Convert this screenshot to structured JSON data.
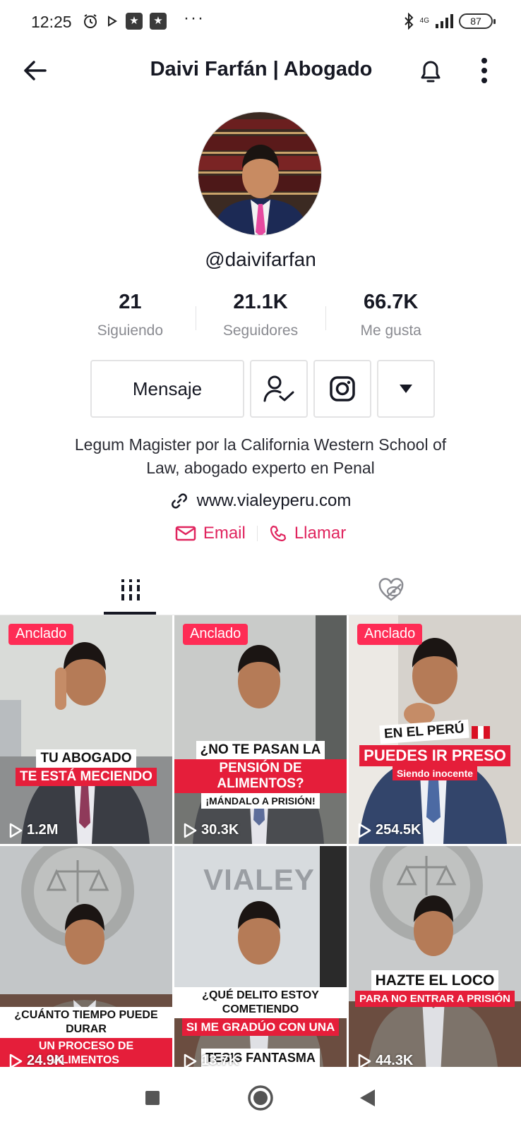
{
  "status_bar": {
    "time": "12:25",
    "network": "4G",
    "battery": "87",
    "more": "···"
  },
  "header": {
    "title": "Daivi Farfán | Abogado",
    "icons": [
      "back-arrow-icon",
      "bell-icon",
      "more-vertical-icon"
    ]
  },
  "profile": {
    "username": "@daivifarfan",
    "stats": [
      {
        "value": "21",
        "label": "Siguiendo"
      },
      {
        "value": "21.1K",
        "label": "Seguidores"
      },
      {
        "value": "66.7K",
        "label": "Me gusta"
      }
    ],
    "message_label": "Mensaje",
    "bio_line1": "Legum Magister por la California Western School of",
    "bio_line2": "Law, abogado experto en Penal",
    "link": "www.vialeyperu.com",
    "email_label": "Email",
    "call_label": "Llamar"
  },
  "colors": {
    "accent": "#fe2c55",
    "contact": "#e0245e",
    "text": "#161823",
    "muted": "#8a8b91"
  },
  "videos": [
    {
      "pinned": "Anclado",
      "views": "1.2M",
      "caption": [
        "TU ABOGADO",
        "TE ESTÁ MECIENDO"
      ]
    },
    {
      "pinned": "Anclado",
      "views": "30.3K",
      "caption": [
        "¿NO TE PASAN LA",
        "PENSIÓN DE ALIMENTOS?",
        "¡MÁNDALO A PRISIÓN!"
      ]
    },
    {
      "pinned": "Anclado",
      "views": "254.5K",
      "caption": [
        "EN EL PERÚ",
        "PUEDES IR PRESO",
        "Siendo inocente"
      ]
    },
    {
      "pinned": "",
      "views": "24.9K",
      "caption": [
        "¿CUÁNTO TIEMPO PUEDE DURAR",
        "UN PROCESO DE ALIMENTOS"
      ]
    },
    {
      "pinned": "",
      "views": "13.7K",
      "caption": [
        "¿QUÉ DELITO ESTOY COMETIENDO",
        "SI ME GRADÚO CON UNA",
        "TESIS FANTASMA"
      ],
      "watermark": "VIALEY"
    },
    {
      "pinned": "",
      "views": "44.3K",
      "caption": [
        "HAZTE EL LOCO",
        "PARA NO ENTRAR A PRISIÓN"
      ]
    }
  ]
}
